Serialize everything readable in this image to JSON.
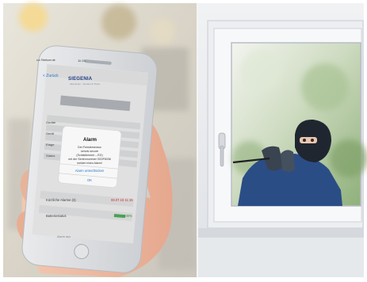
{
  "phone": {
    "status_carrier": "•••• Telekom.de",
    "status_time": "11:15",
    "nav_back": "< Zurück",
    "brand": "SIEGENIA",
    "brand_tagline": "Aluminium · Fenster & Türen",
    "rows": [
      "Geräte",
      "Gerät",
      "Etage",
      "Status"
    ],
    "alert": {
      "title": "Alarm",
      "message_lines": [
        "Der Fenstersensor",
        "senvis secure",
        "(Schlafzimmer – EG)",
        "mit der Seriennummer 0G0F6036",
        "meldet einen Alarm!"
      ],
      "button_suppress": "Alarm unterdrücken",
      "button_ok": "OK"
    },
    "recent_alarms_label": "Kürzliche Alarme (3)",
    "recent_alarms_time": "08.07.15 11:15",
    "battery_label": "Batteriestatus",
    "battery_value": "100%",
    "bottom_label": "Alarm aus"
  },
  "colors": {
    "accent_blue": "#2e79c7",
    "brand_navy": "#1f3c82",
    "alarm_red": "#d0312d",
    "battery_green": "#2f8f3a",
    "window_frame": "#e8ebee",
    "intruder_blue": "#2b4d86"
  }
}
